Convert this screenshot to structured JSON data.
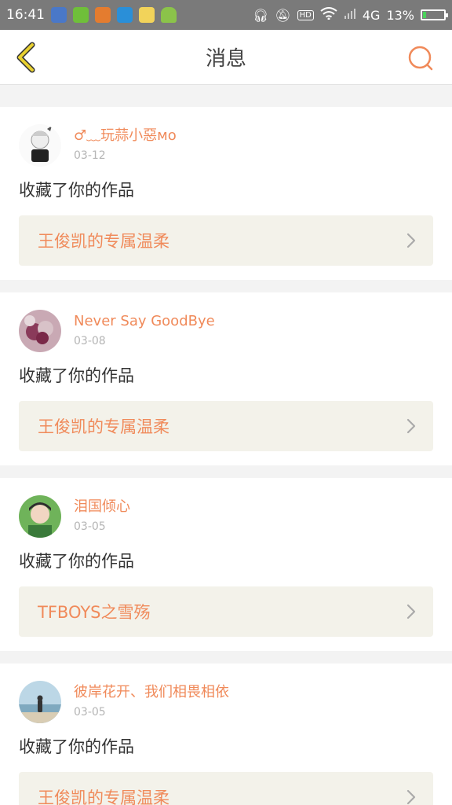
{
  "status_bar": {
    "time": "16:41",
    "network": "4G",
    "battery": "13%"
  },
  "header": {
    "title": "消息"
  },
  "messages": [
    {
      "username": "♂﹏玩蒜小惡мo",
      "date": "03-12",
      "action": "收藏了你的作品",
      "work_title": "王俊凯的专属温柔"
    },
    {
      "username": "Never Say GoodBye",
      "date": "03-08",
      "action": "收藏了你的作品",
      "work_title": "王俊凯的专属温柔"
    },
    {
      "username": "泪国倾心",
      "date": "03-05",
      "action": "收藏了你的作品",
      "work_title": "TFBOYS之雪殇"
    },
    {
      "username": "彼岸花开、我们相畏相依",
      "date": "03-05",
      "action": "收藏了你的作品",
      "work_title": "王俊凯的专属温柔"
    }
  ],
  "colors": {
    "accent": "#f08a5a",
    "back_icon": "#e8d030"
  }
}
